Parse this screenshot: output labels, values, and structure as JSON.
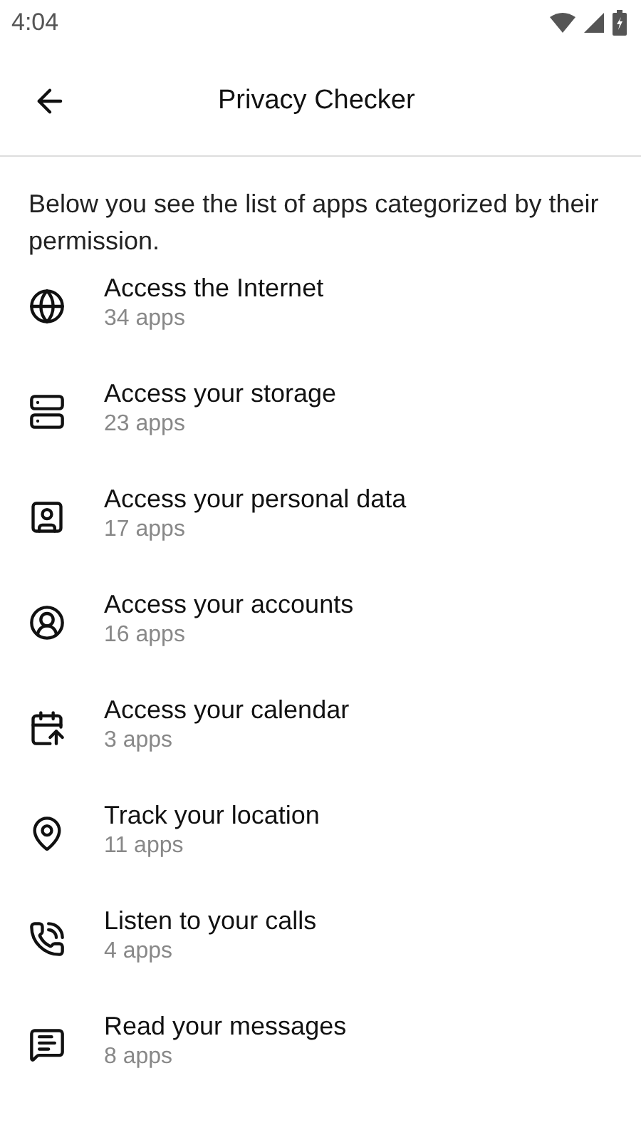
{
  "status_bar": {
    "time": "4:04"
  },
  "toolbar": {
    "title": "Privacy Checker"
  },
  "intro": "Below you see the list of apps categorized by their permission.",
  "permissions": [
    {
      "kind": "globe",
      "title": "Access the Internet",
      "count": "34 apps"
    },
    {
      "kind": "storage",
      "title": "Access your storage",
      "count": "23 apps"
    },
    {
      "kind": "contact",
      "title": "Access your personal data",
      "count": "17 apps"
    },
    {
      "kind": "account",
      "title": "Access your accounts",
      "count": "16 apps"
    },
    {
      "kind": "calendar",
      "title": "Access your calendar",
      "count": "3 apps"
    },
    {
      "kind": "location",
      "title": "Track your location",
      "count": "11 apps"
    },
    {
      "kind": "call",
      "title": "Listen to your calls",
      "count": "4 apps"
    },
    {
      "kind": "message",
      "title": "Read your messages",
      "count": "8 apps"
    }
  ]
}
